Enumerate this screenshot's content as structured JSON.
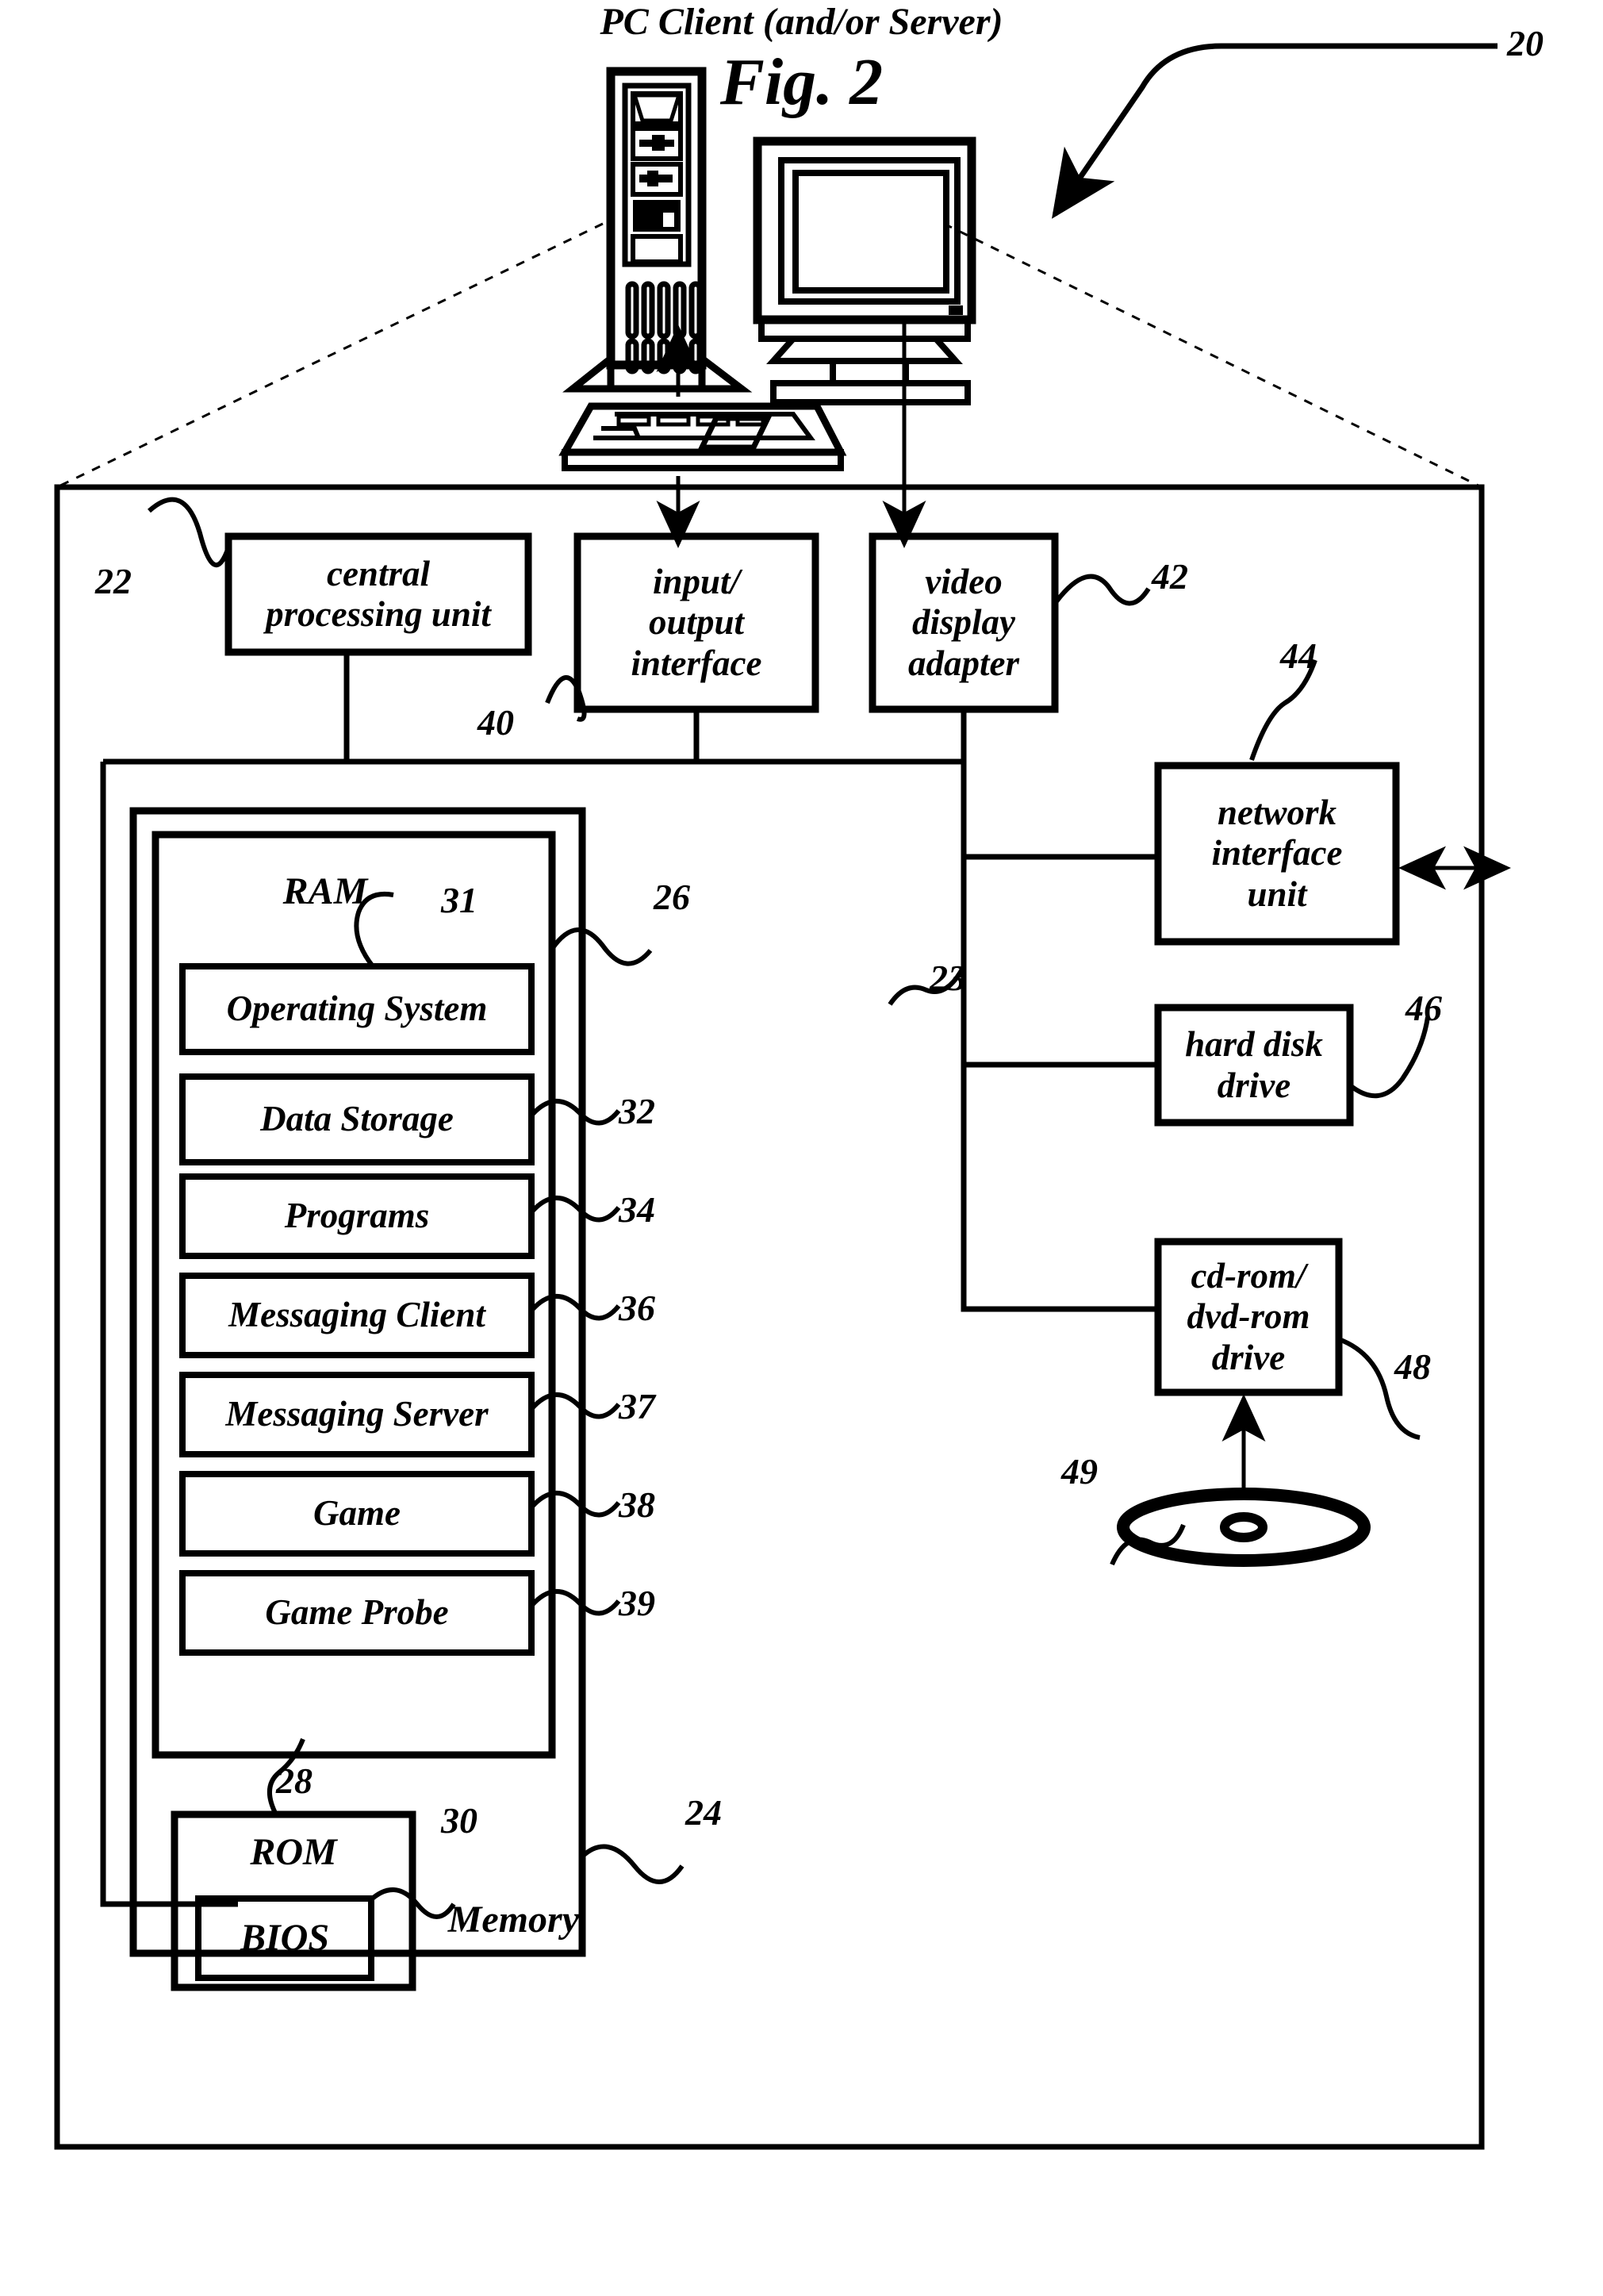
{
  "title": "PC Client (and/or Server)",
  "figure_caption": "Fig. 2",
  "system_ref": "20",
  "blocks": {
    "cpu": {
      "label": "central\nprocessing unit",
      "ref": "22"
    },
    "io": {
      "label": "input/\noutput\ninterface",
      "ref": "40"
    },
    "video": {
      "label": "video\ndisplay\nadapter",
      "ref": "42"
    },
    "network": {
      "label": "network\ninterface\nunit",
      "ref": "44"
    },
    "harddisk": {
      "label": "hard disk\ndrive",
      "ref": "46"
    },
    "cdrom": {
      "label": "cd-rom/\ndvd-rom\ndrive",
      "ref": "48"
    },
    "disc": {
      "label": "",
      "ref": "49"
    },
    "bus": {
      "label": "",
      "ref": "23"
    },
    "memory": {
      "label": "Memory",
      "ref": "24"
    },
    "ram": {
      "label": "RAM",
      "ref": "26"
    },
    "rom": {
      "label": "ROM",
      "ref": "28"
    },
    "bios": {
      "label": "BIOS",
      "ref": "30"
    }
  },
  "ram_items": [
    {
      "label": "Operating System",
      "ref": "31"
    },
    {
      "label": "Data Storage",
      "ref": "32"
    },
    {
      "label": "Programs",
      "ref": "34"
    },
    {
      "label": "Messaging Client",
      "ref": "36"
    },
    {
      "label": "Messaging Server",
      "ref": "37"
    },
    {
      "label": "Game",
      "ref": "38"
    },
    {
      "label": "Game Probe",
      "ref": "39"
    }
  ],
  "colors": {
    "ink": "#000000",
    "paper": "#ffffff"
  }
}
